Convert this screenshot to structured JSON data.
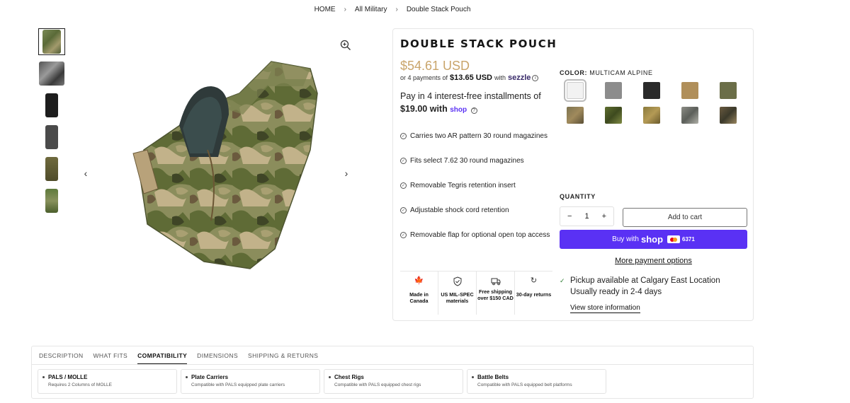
{
  "breadcrumb": [
    "HOME",
    "All Military",
    "Double Stack Pouch"
  ],
  "product": {
    "title": "DOUBLE STACK POUCH",
    "price": "$54.61 USD",
    "installments_prefix": "or 4 payments of",
    "installments_amount": "$13.65 USD",
    "installments_with": "with",
    "sezzle": "sezzle",
    "shoppay_text": "Pay in 4 interest-free installments of",
    "shoppay_amount": "$19.00",
    "shoppay_with": "with",
    "shoppay_brand": "shop"
  },
  "features": [
    "Carries two AR pattern 30 round magazines",
    "Fits select 7.62 30 round magazines",
    "Removable Tegris retention insert",
    "Adjustable shock cord retention",
    "Removable flap for optional open top access"
  ],
  "badges": [
    {
      "icon": "maple-leaf-icon",
      "text": "Made in Canada"
    },
    {
      "icon": "shield-check-icon",
      "text": "US MIL-SPEC materials"
    },
    {
      "icon": "truck-icon",
      "text": "Free shipping over $150 CAD"
    },
    {
      "icon": "refresh-icon",
      "text": "30-day returns"
    }
  ],
  "color": {
    "label": "COLOR:",
    "selected": "MULTICAM ALPINE",
    "swatches": [
      "#f2f2f2",
      "#8c8c8c",
      "#2a2a2a",
      "#b08f5a",
      "#6b6e48",
      "#7d7350",
      "#5e6e2f",
      "#8a7a3c",
      "#8d8d86",
      "#6a5a40"
    ]
  },
  "quantity": {
    "label": "QUANTITY",
    "value": "1",
    "minus": "−",
    "plus": "+"
  },
  "buttons": {
    "add_to_cart": "Add to cart",
    "buy_with": "Buy with",
    "buy_brand": "shop",
    "card_last4": "6371",
    "more_payment": "More payment options"
  },
  "pickup": {
    "available": "Pickup available at Calgary East Location",
    "ready": "Usually ready in 2-4 days",
    "link": "View store information"
  },
  "tabs": [
    "DESCRIPTION",
    "WHAT FITS",
    "COMPATIBILITY",
    "DIMENSIONS",
    "SHIPPING & RETURNS"
  ],
  "active_tab": "COMPATIBILITY",
  "compatibility": [
    {
      "title": "PALS / MOLLE",
      "sub": "Requires 2 Columns of MOLLE"
    },
    {
      "title": "Plate Carriers",
      "sub": "Compatible with PALS equipped plate carriers"
    },
    {
      "title": "Chest Rigs",
      "sub": "Compatible with PALS equipped chest rigs"
    },
    {
      "title": "Battle Belts",
      "sub": "Compatible with PALS equipped belt platforms"
    }
  ],
  "accent_colors": {
    "price": "#c9a56b",
    "shop_purple": "#5a31f4"
  }
}
